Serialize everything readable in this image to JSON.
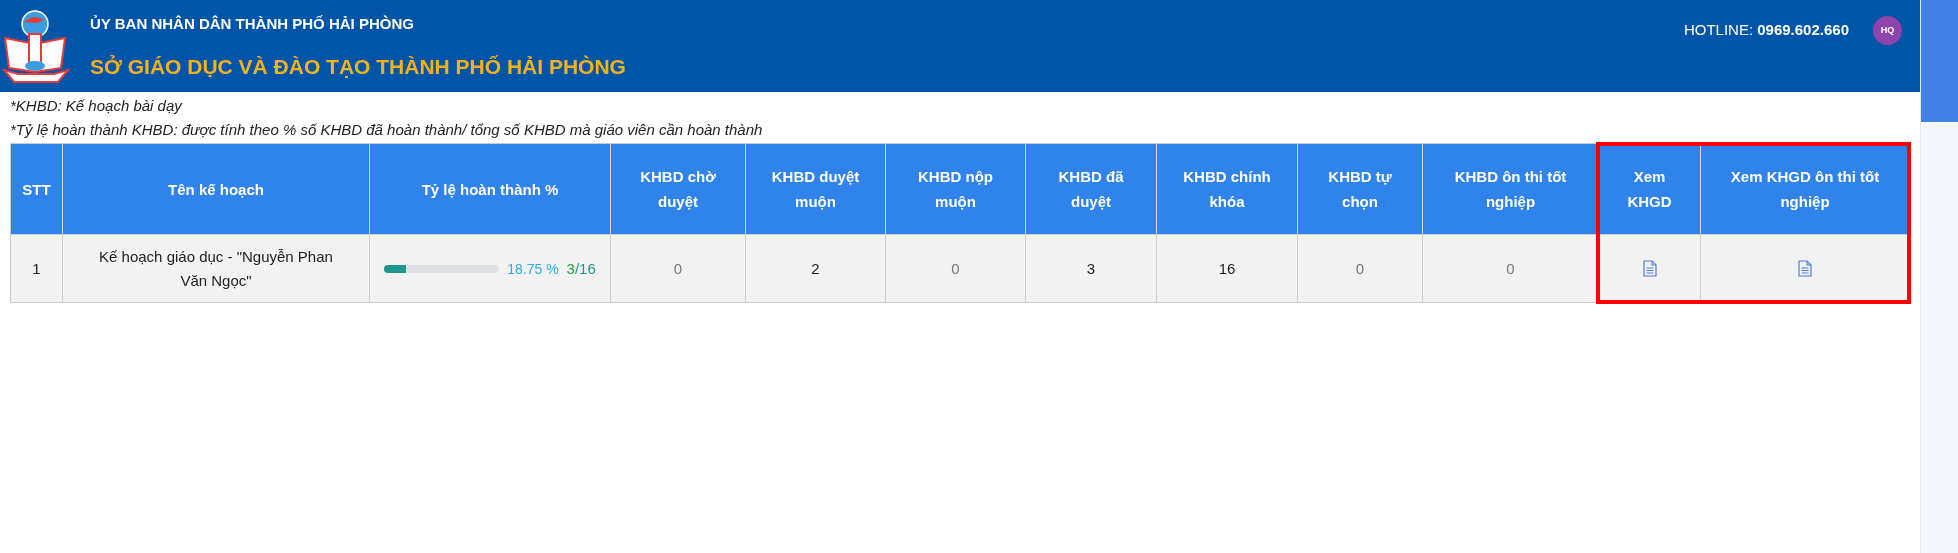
{
  "header": {
    "org": "ỦY BAN NHÂN DÂN THÀNH PHỐ HẢI PHÒNG",
    "title": "SỞ GIÁO DỤC VÀ ĐÀO TẠO THÀNH PHỐ HẢI PHÒNG",
    "hotline_label": "HOTLINE:",
    "hotline_number": "0969.602.660",
    "avatar": "HQ"
  },
  "notes": [
    "*KHBD: Kế hoạch bài dạy",
    "*Tỷ lệ hoàn thành KHBD: được tính theo % số KHBD đã hoàn thành/ tổng số KHBD mà giáo viên cần hoàn thành"
  ],
  "table": {
    "columns": [
      {
        "label": "STT",
        "highlighted": false
      },
      {
        "label": "Tên kế hoạch",
        "highlighted": false
      },
      {
        "label": "Tỷ lệ hoàn thành %",
        "highlighted": false
      },
      {
        "label": "KHBD chờ duyệt",
        "highlighted": false
      },
      {
        "label": "KHBD duyệt muộn",
        "highlighted": false
      },
      {
        "label": "KHBD nộp muộn",
        "highlighted": false
      },
      {
        "label": "KHBD đã duyệt",
        "highlighted": false
      },
      {
        "label": "KHBD chính khóa",
        "highlighted": false
      },
      {
        "label": "KHBD tự chọn",
        "highlighted": false
      },
      {
        "label": "KHBD ôn thi tốt nghiệp",
        "highlighted": false
      },
      {
        "label": "Xem KHGD",
        "highlighted": true
      },
      {
        "label": "Xem KHGD ôn thi tốt nghiệp",
        "highlighted": true
      }
    ],
    "rows": [
      {
        "cells": [
          {
            "kind": "text",
            "text": "1",
            "muted": false
          },
          {
            "kind": "text",
            "text": "Kế hoạch giáo dục - \"Nguyễn Phan Văn Ngọc\"",
            "muted": false
          },
          {
            "kind": "progress",
            "level": 0.1875,
            "percent": "18.75 %",
            "done": "3",
            "total": "/16"
          },
          {
            "kind": "text",
            "text": "0",
            "muted": true
          },
          {
            "kind": "text",
            "text": "2",
            "muted": false
          },
          {
            "kind": "text",
            "text": "0",
            "muted": true
          },
          {
            "kind": "text",
            "text": "3",
            "muted": false
          },
          {
            "kind": "text",
            "text": "16",
            "muted": false
          },
          {
            "kind": "text",
            "text": "0",
            "muted": true
          },
          {
            "kind": "text",
            "text": "0",
            "muted": true
          },
          {
            "kind": "icon"
          },
          {
            "kind": "icon"
          }
        ]
      }
    ]
  }
}
